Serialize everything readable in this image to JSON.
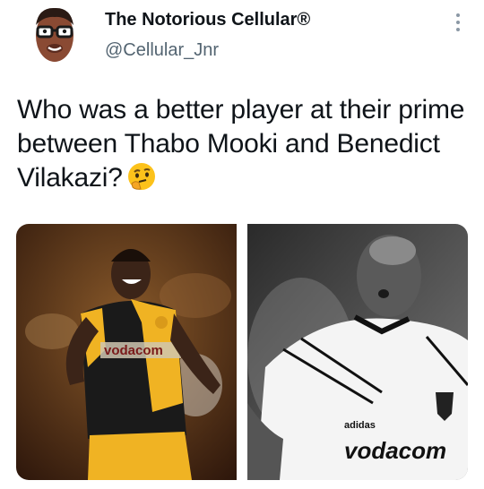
{
  "tweet": {
    "display_name": "The Notorious Cellular®",
    "handle": "@Cellular_Jnr",
    "text": "Who was a better player at their prime between Thabo Mooki and Benedict Vilakazi?",
    "emoji": "thinking-face"
  },
  "media": {
    "photos": [
      {
        "kit_sponsor": "vodacom",
        "kit_colors": [
          "#f0b323",
          "#1a1a1a"
        ]
      },
      {
        "kit_sponsor": "vodacom",
        "kit_brand": "adidas",
        "tone": "grayscale"
      }
    ]
  },
  "icons": {
    "more": "more-vertical-icon"
  },
  "colors": {
    "text": "#0f1419",
    "secondary": "#536471"
  }
}
